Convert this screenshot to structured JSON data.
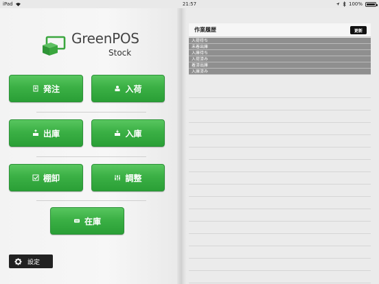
{
  "statusbar": {
    "device": "iPad",
    "time": "21:57",
    "battery": "100%"
  },
  "logo": {
    "brand": "GreenPOS",
    "sub": "Stock"
  },
  "buttons": {
    "order": "発注",
    "receive": "入荷",
    "ship_out": "出庫",
    "stock_in": "入庫",
    "inventory": "棚卸",
    "adjust": "調整",
    "stock": "在庫"
  },
  "settings": {
    "label": "設定"
  },
  "history": {
    "title": "作業履歴",
    "refresh_label": "更新",
    "items": [
      "入荷待ち",
      "未着出庫",
      "入庫待ち",
      "入荷済み",
      "着済出庫",
      "入庫済み"
    ]
  },
  "colors": {
    "button_green": "#3bb045",
    "logo_green": "#3aa63e",
    "row_gray": "#8f8f8f"
  }
}
